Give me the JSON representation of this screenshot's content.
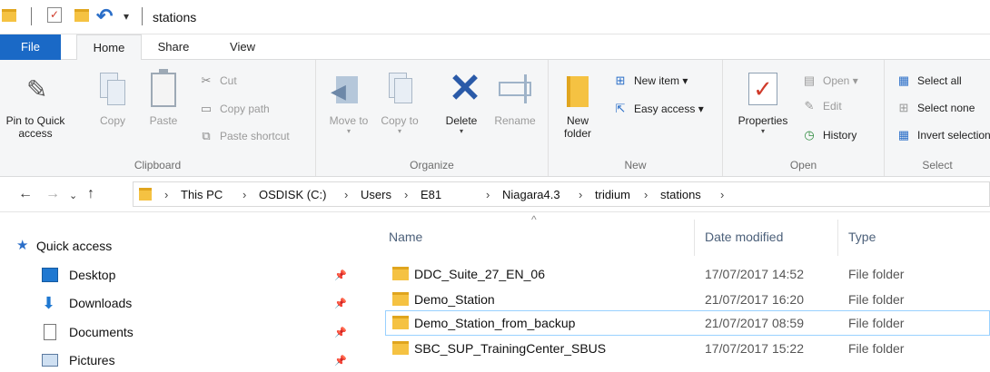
{
  "window": {
    "title": "stations",
    "quick_access_toolbar": [
      "folder-icon",
      "properties-icon",
      "new-folder-icon",
      "undo-icon",
      "customize-dropdown-icon"
    ]
  },
  "tabs": {
    "file": "File",
    "home": "Home",
    "share": "Share",
    "view": "View",
    "active": "Home"
  },
  "ribbon": {
    "clipboard": {
      "label": "Clipboard",
      "pin_to_quick_access": "Pin to Quick access",
      "copy": "Copy",
      "paste": "Paste",
      "cut": "Cut",
      "copy_path": "Copy path",
      "paste_shortcut": "Paste shortcut"
    },
    "organize": {
      "label": "Organize",
      "move_to": "Move to",
      "copy_to": "Copy to",
      "delete": "Delete",
      "rename": "Rename"
    },
    "new": {
      "label": "New",
      "new_folder": "New folder",
      "new_item": "New item",
      "easy_access": "Easy access"
    },
    "open": {
      "label": "Open",
      "properties": "Properties",
      "open": "Open",
      "edit": "Edit",
      "history": "History"
    },
    "select": {
      "label": "Select",
      "select_all": "Select all",
      "select_none": "Select none",
      "invert_selection": "Invert selection"
    }
  },
  "address": {
    "breadcrumbs": [
      "This PC",
      "OSDISK (C:)",
      "Users",
      "E81",
      "Niagara4.3",
      "tridium",
      "stations"
    ]
  },
  "nav_pane": {
    "quick_access": "Quick access",
    "items": [
      {
        "label": "Desktop",
        "icon": "desktop-icon",
        "pinned": true
      },
      {
        "label": "Downloads",
        "icon": "downloads-icon",
        "pinned": true
      },
      {
        "label": "Documents",
        "icon": "documents-icon",
        "pinned": true
      },
      {
        "label": "Pictures",
        "icon": "pictures-icon",
        "pinned": true
      }
    ]
  },
  "file_list": {
    "columns": {
      "name": "Name",
      "date_modified": "Date modified",
      "type": "Type"
    },
    "sort_column": "Name",
    "rows": [
      {
        "name": "DDC_Suite_27_EN_06",
        "date": "17/07/2017 14:52",
        "type": "File folder",
        "selected": false
      },
      {
        "name": "Demo_Station",
        "date": "21/07/2017 16:20",
        "type": "File folder",
        "selected": false
      },
      {
        "name": "Demo_Station_from_backup",
        "date": "21/07/2017 08:59",
        "type": "File folder",
        "selected": true
      },
      {
        "name": "SBC_SUP_TrainingCenter_SBUS",
        "date": "17/07/2017 15:22",
        "type": "File folder",
        "selected": false
      }
    ]
  },
  "colors": {
    "file_tab": "#1a69c6",
    "ribbon_bg": "#f5f6f7",
    "folder_yellow": "#f5c242",
    "selection_border": "#99d1ff",
    "header_text": "#4c607a"
  }
}
